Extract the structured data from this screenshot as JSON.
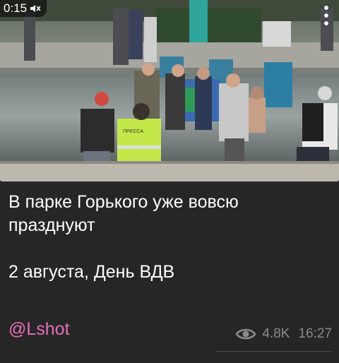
{
  "video": {
    "timer": "0:15",
    "vest_text": "ПРЕССА",
    "icons": {
      "sound": "speaker-muted-icon",
      "menu": "more-vertical-icon"
    }
  },
  "message": {
    "text": "В парке Горького уже вовсю\nпразднуют\n\n2 августа, День ВДВ",
    "channel": "@Lshot",
    "views": "4.8K",
    "time": "16:27"
  },
  "colors": {
    "background": "#262626",
    "text": "#ffffff",
    "link": "#e66fb8",
    "meta": "#8a8a8a"
  }
}
